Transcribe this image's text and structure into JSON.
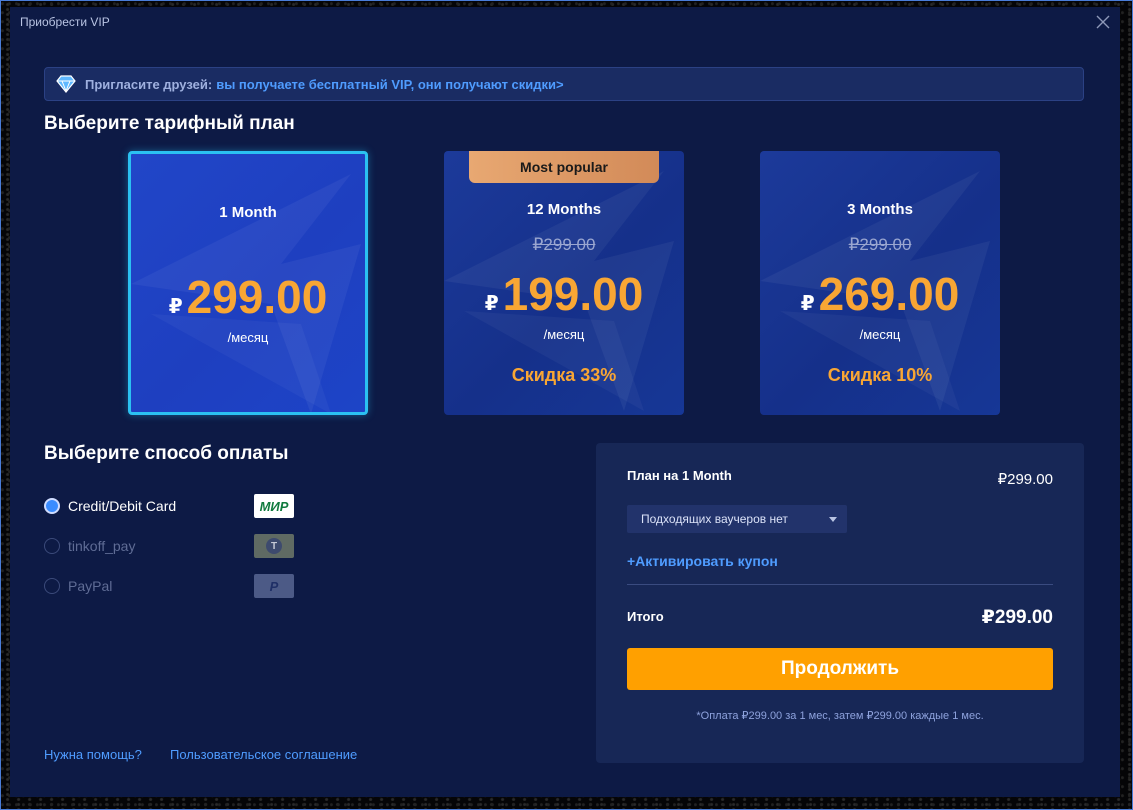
{
  "window": {
    "title": "Приобрести VIP"
  },
  "invite": {
    "prefix": "Пригласите друзей:",
    "link": "вы получаете бесплатный VIP, они получают скидки>"
  },
  "plans_section": {
    "title": "Выберите тарифный план"
  },
  "plans": [
    {
      "name": "1 Month",
      "old_price": "",
      "currency": "₽",
      "price": "299.00",
      "per": "/месяц",
      "discount": "",
      "badge": "",
      "selected": true
    },
    {
      "name": "12 Months",
      "old_price": "₽299.00",
      "currency": "₽",
      "price": "199.00",
      "per": "/месяц",
      "discount": "Скидка 33%",
      "badge": "Most popular",
      "selected": false
    },
    {
      "name": "3 Months",
      "old_price": "₽299.00",
      "currency": "₽",
      "price": "269.00",
      "per": "/месяц",
      "discount": "Скидка 10%",
      "badge": "",
      "selected": false
    }
  ],
  "payment_section": {
    "title": "Выберите способ оплаты"
  },
  "payment_methods": [
    {
      "label": "Credit/Debit Card",
      "logo": "МИР",
      "checked": true,
      "enabled": true
    },
    {
      "label": "tinkoff_pay",
      "logo": "T",
      "checked": false,
      "enabled": false
    },
    {
      "label": "PayPal",
      "logo": "P",
      "checked": false,
      "enabled": false
    }
  ],
  "summary": {
    "plan_label": "План на 1 Month",
    "plan_price": "₽299.00",
    "voucher": "Подходящих ваучеров нет",
    "coupon": "+Активировать купон",
    "total_label": "Итого",
    "total_value": "₽299.00",
    "continue": "Продолжить",
    "footnote": "*Оплата ₽299.00 за 1 мес, затем ₽299.00 каждые 1 мес."
  },
  "footer": {
    "help": "Нужна помощь?",
    "agreement": "Пользовательское соглашение"
  },
  "colors": {
    "accent_orange": "#ffa000",
    "price_orange": "#f8a634",
    "link_blue": "#4f9cff",
    "selected_border": "#2bc1f2"
  }
}
